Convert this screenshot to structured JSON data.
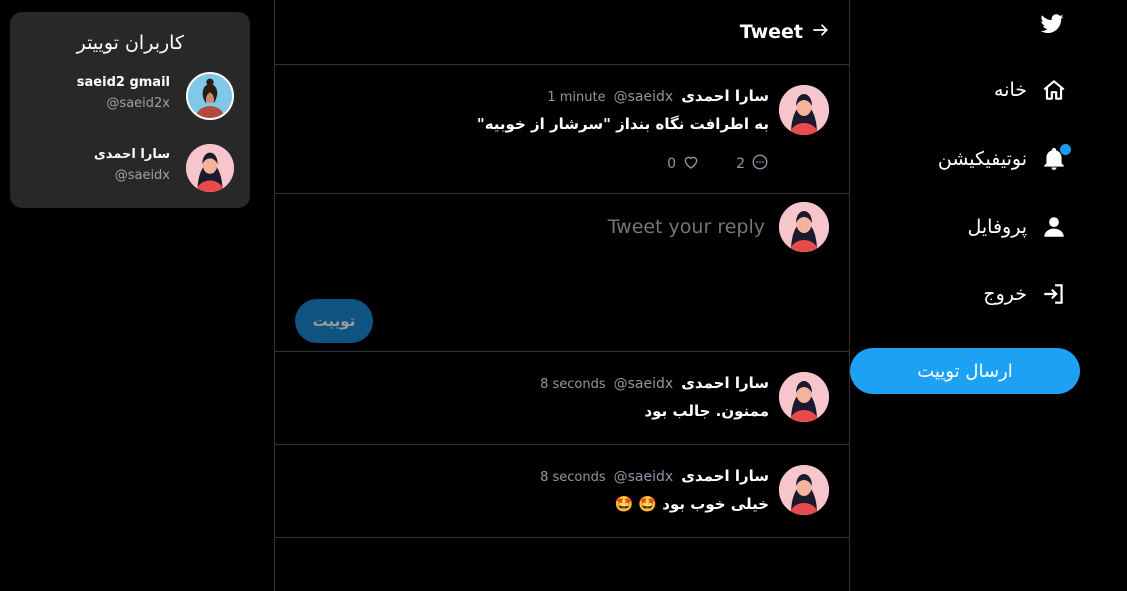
{
  "header": {
    "title": "Tweet",
    "back_icon": "arrow-right-icon"
  },
  "nav": {
    "logo_icon": "twitter-bird-icon",
    "items": [
      {
        "label": "خانه",
        "icon": "home-icon"
      },
      {
        "label": "نوتیفیکیشن",
        "icon": "bell-icon"
      },
      {
        "label": "پروفایل",
        "icon": "user-icon"
      },
      {
        "label": "خروج",
        "icon": "logout-icon"
      }
    ],
    "send_button": "ارسال توییت",
    "accent": "#1da1f2"
  },
  "main_tweet": {
    "name": "سارا احمدی",
    "handle": "@saeidx",
    "time": "1 minute",
    "text": "به اطرافت نگاه بنداز \"سرشار از خوبیه\"",
    "likes": "0",
    "comments": "2"
  },
  "composer": {
    "placeholder": "Tweet your reply",
    "button": "توییت"
  },
  "replies": [
    {
      "name": "سارا احمدی",
      "handle": "@saeidx",
      "time": "8 seconds",
      "text": "ممنون. جالب بود"
    },
    {
      "name": "سارا احمدی",
      "handle": "@saeidx",
      "time": "8 seconds",
      "text": "خیلی خوب بود 🤩 🤩"
    }
  ],
  "users_panel": {
    "title": "کاربران توییتر",
    "users": [
      {
        "name": "saeid2 gmail",
        "handle": "@saeid2x"
      },
      {
        "name": "سارا احمدی",
        "handle": "@saeidx"
      }
    ]
  }
}
